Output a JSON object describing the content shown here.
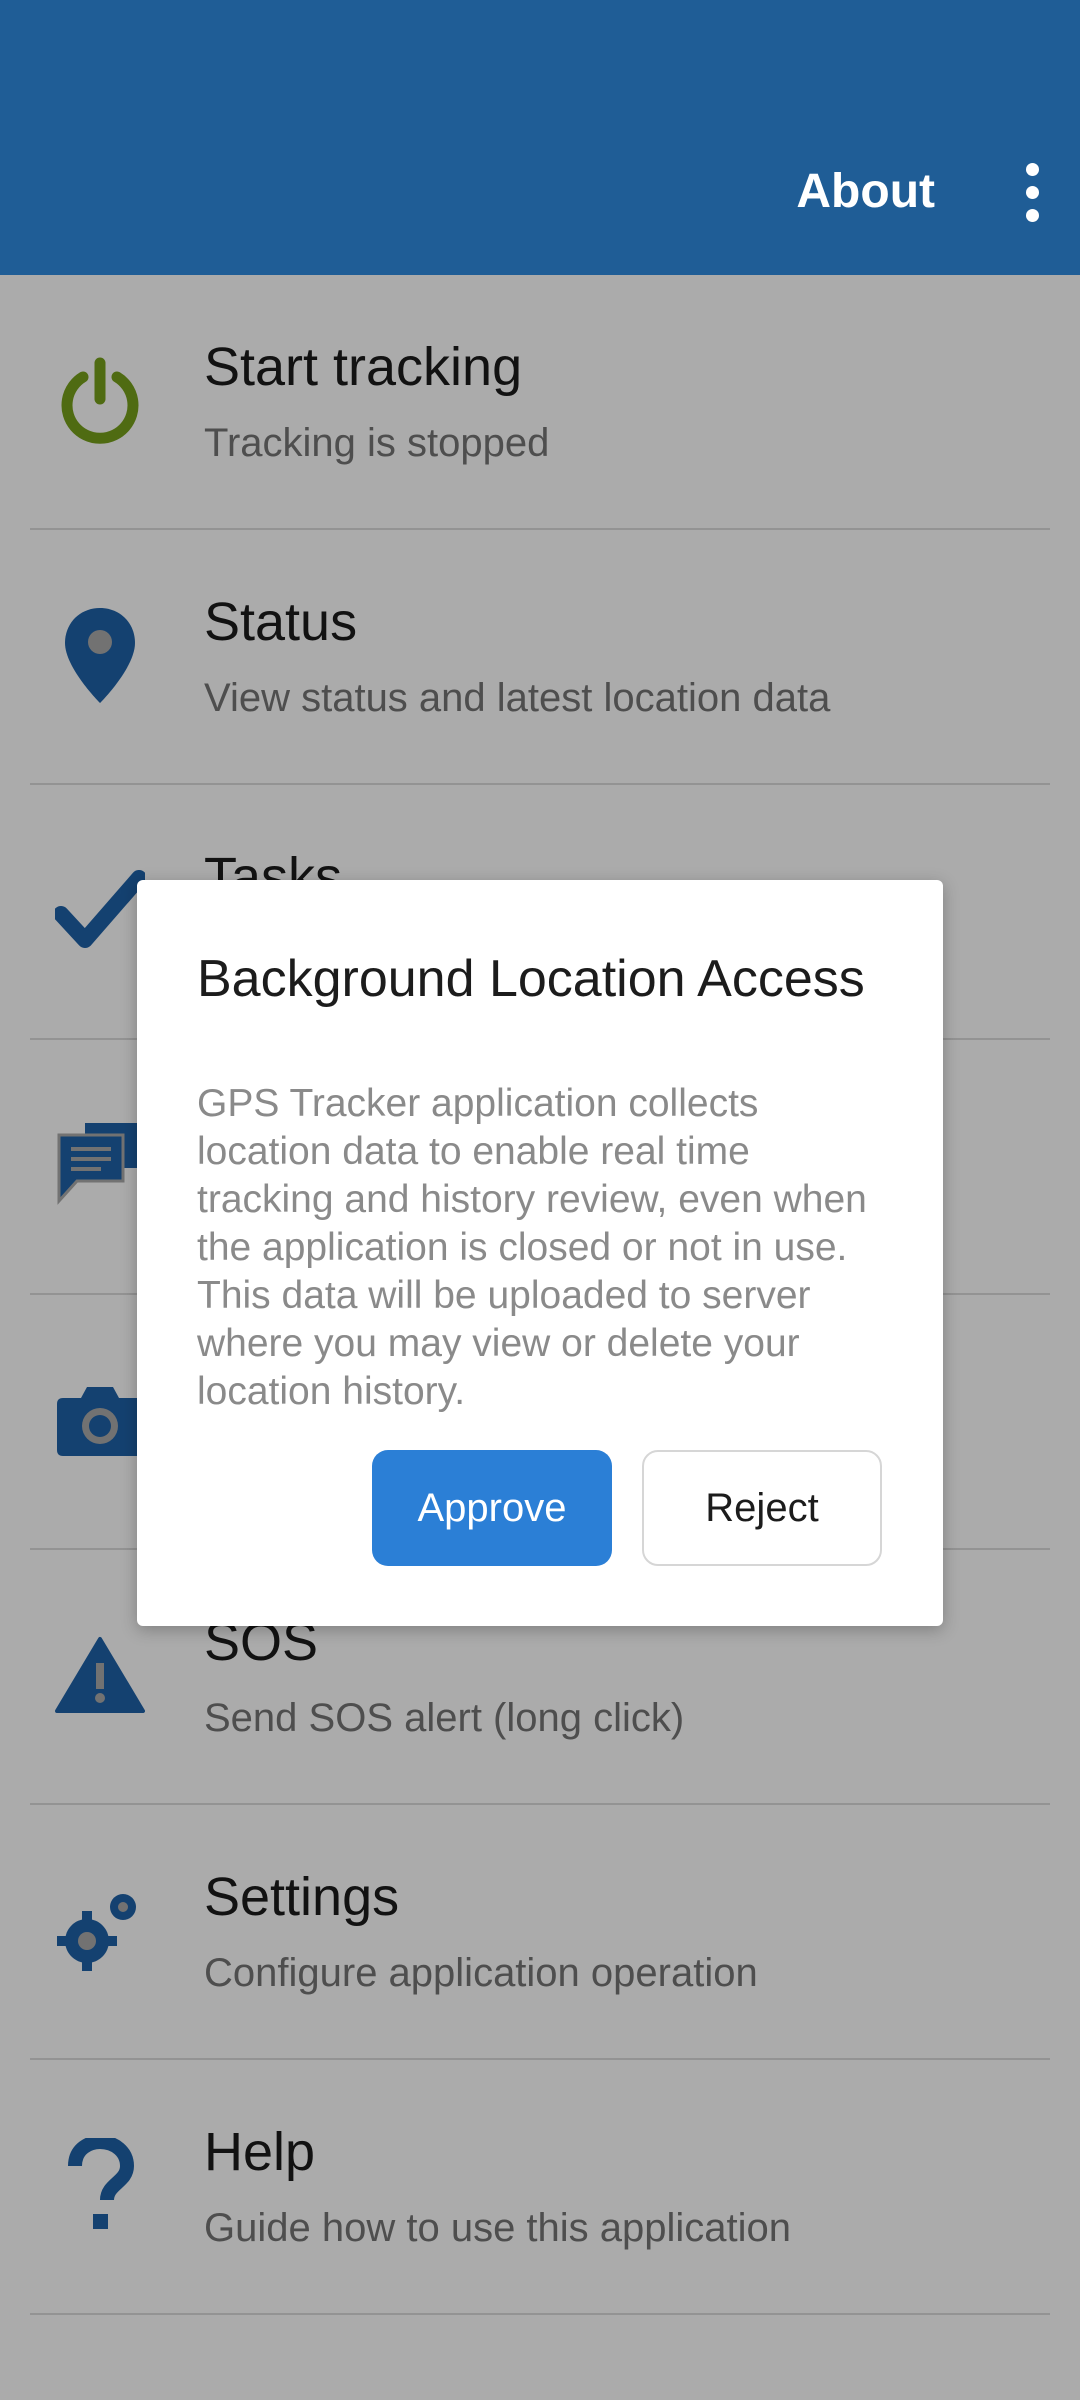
{
  "app_bar": {
    "about_label": "About",
    "more_icon": "more-vert-icon",
    "background_color": "#1f5d96"
  },
  "menu": {
    "items": [
      {
        "title": "Start tracking",
        "subtitle": "Tracking is stopped",
        "icon": "power-icon",
        "icon_color": "#76a01b"
      },
      {
        "title": "Status",
        "subtitle": "View status and latest location data",
        "icon": "location-pin-icon",
        "icon_color": "#1f62a8"
      },
      {
        "title": "Tasks",
        "subtitle": "",
        "icon": "checkmark-icon",
        "icon_color": "#1f62a8"
      },
      {
        "title": "",
        "subtitle": "",
        "icon": "chat-icon",
        "icon_color": "#1f62a8"
      },
      {
        "title": "",
        "subtitle": "",
        "icon": "camera-icon",
        "icon_color": "#1f62a8"
      },
      {
        "title": "SOS",
        "subtitle": "Send SOS alert (long click)",
        "icon": "warning-icon",
        "icon_color": "#1f62a8"
      },
      {
        "title": "Settings",
        "subtitle": "Configure application operation",
        "icon": "gears-icon",
        "icon_color": "#1f62a8"
      },
      {
        "title": "Help",
        "subtitle": "Guide how to use this application",
        "icon": "help-icon",
        "icon_color": "#1f62a8"
      }
    ]
  },
  "dialog": {
    "title": "Background Location Access",
    "body": "GPS Tracker application collects location data to enable real time tracking and history review, even when the application is closed or not in use. This data will be uploaded to server where you may view or delete your location history.",
    "approve_label": "Approve",
    "reject_label": "Reject",
    "approve_color": "#2b7fd6"
  }
}
